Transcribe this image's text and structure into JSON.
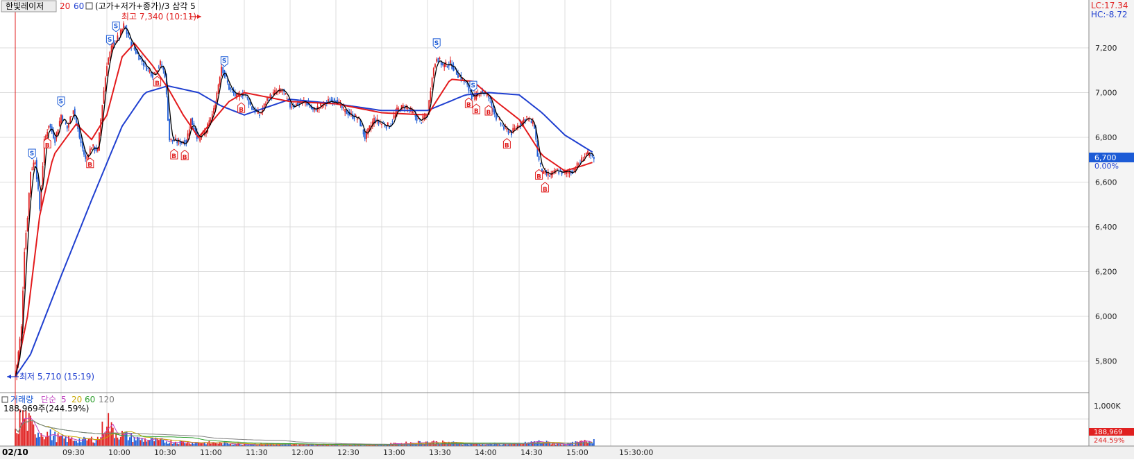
{
  "header": {
    "stock_name": "한빛레이저",
    "ma_periods": [
      "20",
      "60"
    ],
    "chart_mode": "(고가+저가+종가)/3 삼각 5",
    "high_label": "최고 7,340 (10:11)",
    "low_label": "최저 5,710 (15:19)",
    "lc_label": "LC:17.34",
    "hc_label": "HC:-8.72"
  },
  "current": {
    "price_label": "6,700",
    "change_label": "0.00%"
  },
  "volume_panel": {
    "title": "거래량",
    "ma_label": "단순",
    "ma_periods": [
      "5",
      "20",
      "60",
      "120"
    ],
    "value_label": "188,969주(244.59%)",
    "axis_label": "1,000K",
    "current_volume_label": "188,969",
    "current_percent_label": "244.59%"
  },
  "x_axis": {
    "date_label": "02/10",
    "ticks": [
      "09:30",
      "10:00",
      "10:30",
      "11:00",
      "11:30",
      "12:00",
      "12:30",
      "13:00",
      "13:30",
      "14:00",
      "14:30",
      "15:00",
      "15:30:00"
    ]
  },
  "y_axis": {
    "ticks": [
      "7,200",
      "7,000",
      "6,800",
      "6,600",
      "6,400",
      "6,200",
      "6,000",
      "5,800"
    ]
  },
  "signal_letters": {
    "buy": "B",
    "sell": "S"
  },
  "colors": {
    "up": "#e02020",
    "down": "#1c5bd6",
    "ma_short": "#000000",
    "ma_20": "#e31a1c",
    "ma_60": "#1f3fd0",
    "grid": "#dcdcdc",
    "current_box": "#1c5bd6",
    "vol_ma5": "#c040c0",
    "vol_ma20": "#c9a800",
    "vol_ma60": "#30a030",
    "vol_ma120": "#808080"
  },
  "chart_data": {
    "type": "candlestick",
    "y_range": [
      5700,
      7380
    ],
    "volume_range": [
      0,
      1000000
    ],
    "anchors": [
      [
        "09:00",
        5730
      ],
      [
        "09:04",
        5950
      ],
      [
        "09:06",
        6300
      ],
      [
        "09:08",
        6450
      ],
      [
        "09:10",
        6650
      ],
      [
        "09:13",
        6700
      ],
      [
        "09:16",
        6480
      ],
      [
        "09:19",
        6780
      ],
      [
        "09:22",
        6860
      ],
      [
        "09:26",
        6790
      ],
      [
        "09:30",
        6900
      ],
      [
        "09:34",
        6840
      ],
      [
        "09:38",
        6930
      ],
      [
        "09:42",
        6800
      ],
      [
        "09:46",
        6700
      ],
      [
        "09:50",
        6760
      ],
      [
        "09:54",
        6740
      ],
      [
        "09:57",
        6950
      ],
      [
        "10:00",
        7130
      ],
      [
        "10:04",
        7220
      ],
      [
        "10:08",
        7250
      ],
      [
        "10:11",
        7300
      ],
      [
        "10:15",
        7230
      ],
      [
        "10:20",
        7170
      ],
      [
        "10:25",
        7120
      ],
      [
        "10:30",
        7080
      ],
      [
        "10:35",
        7130
      ],
      [
        "10:38",
        7080
      ],
      [
        "10:41",
        6790
      ],
      [
        "10:46",
        6780
      ],
      [
        "10:52",
        6780
      ],
      [
        "10:55",
        6880
      ],
      [
        "11:00",
        6790
      ],
      [
        "11:05",
        6830
      ],
      [
        "11:10",
        6920
      ],
      [
        "11:15",
        7120
      ],
      [
        "11:20",
        7020
      ],
      [
        "11:25",
        6980
      ],
      [
        "11:30",
        7000
      ],
      [
        "11:35",
        6930
      ],
      [
        "11:40",
        6900
      ],
      [
        "11:45",
        6970
      ],
      [
        "11:50",
        7000
      ],
      [
        "11:55",
        7010
      ],
      [
        "12:00",
        6940
      ],
      [
        "12:05",
        6950
      ],
      [
        "12:10",
        6960
      ],
      [
        "12:15",
        6920
      ],
      [
        "12:20",
        6940
      ],
      [
        "12:25",
        6960
      ],
      [
        "12:30",
        6970
      ],
      [
        "12:35",
        6920
      ],
      [
        "12:40",
        6900
      ],
      [
        "12:45",
        6880
      ],
      [
        "12:49",
        6800
      ],
      [
        "12:55",
        6880
      ],
      [
        "13:00",
        6860
      ],
      [
        "13:05",
        6850
      ],
      [
        "13:10",
        6920
      ],
      [
        "13:15",
        6940
      ],
      [
        "13:20",
        6910
      ],
      [
        "13:25",
        6870
      ],
      [
        "13:30",
        6900
      ],
      [
        "13:33",
        7080
      ],
      [
        "13:36",
        7160
      ],
      [
        "13:40",
        7120
      ],
      [
        "13:45",
        7130
      ],
      [
        "13:50",
        7080
      ],
      [
        "13:55",
        7040
      ],
      [
        "13:58",
        7000
      ],
      [
        "14:00",
        6970
      ],
      [
        "14:05",
        7010
      ],
      [
        "14:10",
        6980
      ],
      [
        "14:15",
        6890
      ],
      [
        "14:20",
        6840
      ],
      [
        "14:25",
        6820
      ],
      [
        "14:30",
        6860
      ],
      [
        "14:35",
        6890
      ],
      [
        "14:40",
        6850
      ],
      [
        "14:42",
        6720
      ],
      [
        "14:45",
        6640
      ],
      [
        "14:50",
        6630
      ],
      [
        "14:55",
        6650
      ],
      [
        "15:00",
        6640
      ],
      [
        "15:05",
        6650
      ],
      [
        "15:10",
        6690
      ],
      [
        "15:14",
        6730
      ],
      [
        "15:19",
        6700
      ]
    ],
    "volume_anchors": [
      [
        "09:00",
        420000
      ],
      [
        "09:03",
        900000
      ],
      [
        "09:06",
        1000000
      ],
      [
        "09:09",
        760000
      ],
      [
        "09:12",
        560000
      ],
      [
        "09:20",
        430000
      ],
      [
        "09:30",
        260000
      ],
      [
        "09:45",
        200000
      ],
      [
        "09:55",
        260000
      ],
      [
        "10:00",
        1000000
      ],
      [
        "10:03",
        560000
      ],
      [
        "10:08",
        420000
      ],
      [
        "10:20",
        240000
      ],
      [
        "10:40",
        160000
      ],
      [
        "11:00",
        120000
      ],
      [
        "11:30",
        80000
      ],
      [
        "12:00",
        60000
      ],
      [
        "12:30",
        45000
      ],
      [
        "13:00",
        50000
      ],
      [
        "13:30",
        140000
      ],
      [
        "13:45",
        110000
      ],
      [
        "14:00",
        80000
      ],
      [
        "14:30",
        70000
      ],
      [
        "14:42",
        150000
      ],
      [
        "15:00",
        60000
      ],
      [
        "15:19",
        188969
      ]
    ],
    "ma20_anchors": [
      [
        "09:00",
        5730
      ],
      [
        "09:08",
        6000
      ],
      [
        "09:16",
        6450
      ],
      [
        "09:25",
        6720
      ],
      [
        "09:40",
        6860
      ],
      [
        "09:50",
        6790
      ],
      [
        "10:00",
        6900
      ],
      [
        "10:10",
        7160
      ],
      [
        "10:18",
        7220
      ],
      [
        "10:30",
        7120
      ],
      [
        "10:40",
        7020
      ],
      [
        "10:50",
        6900
      ],
      [
        "11:00",
        6800
      ],
      [
        "11:10",
        6880
      ],
      [
        "11:20",
        6960
      ],
      [
        "11:30",
        7000
      ],
      [
        "12:00",
        6960
      ],
      [
        "12:30",
        6950
      ],
      [
        "13:00",
        6910
      ],
      [
        "13:30",
        6900
      ],
      [
        "13:45",
        7060
      ],
      [
        "14:00",
        7050
      ],
      [
        "14:15",
        6960
      ],
      [
        "14:30",
        6880
      ],
      [
        "14:45",
        6720
      ],
      [
        "15:00",
        6650
      ],
      [
        "15:10",
        6670
      ],
      [
        "15:19",
        6690
      ]
    ],
    "ma60_anchors": [
      [
        "09:00",
        5730
      ],
      [
        "09:10",
        5830
      ],
      [
        "09:30",
        6180
      ],
      [
        "09:50",
        6520
      ],
      [
        "10:10",
        6850
      ],
      [
        "10:25",
        7000
      ],
      [
        "10:40",
        7030
      ],
      [
        "11:00",
        7000
      ],
      [
        "11:15",
        6940
      ],
      [
        "11:30",
        6900
      ],
      [
        "12:00",
        6970
      ],
      [
        "12:30",
        6950
      ],
      [
        "13:00",
        6920
      ],
      [
        "13:30",
        6920
      ],
      [
        "13:55",
        6990
      ],
      [
        "14:10",
        7000
      ],
      [
        "14:30",
        6990
      ],
      [
        "14:45",
        6910
      ],
      [
        "15:00",
        6810
      ],
      [
        "15:19",
        6730
      ]
    ],
    "buy_signal_times": [
      "09:21",
      "09:49",
      "10:33",
      "10:44",
      "10:51",
      "11:28",
      "13:57",
      "14:02",
      "14:10",
      "14:22",
      "14:43",
      "14:47"
    ],
    "sell_signal_times": [
      "09:11",
      "09:30",
      "10:02",
      "10:06",
      "11:17",
      "13:36",
      "14:00"
    ]
  }
}
